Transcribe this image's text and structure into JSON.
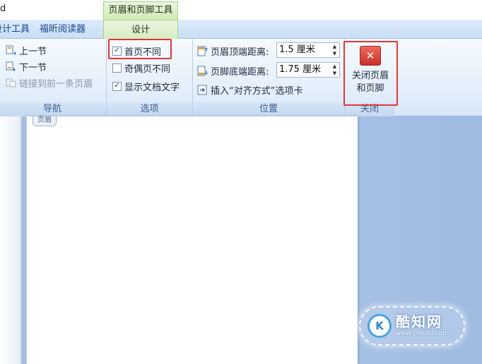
{
  "titlebar": {
    "doc_title": "d",
    "context_tool": "页眉和页脚工具"
  },
  "tabs": {
    "items": [
      {
        "label": "设计工具"
      },
      {
        "label": "福昕阅读器"
      },
      {
        "label": "设计"
      }
    ]
  },
  "ribbon": {
    "navigation": {
      "label": "导航",
      "items": [
        {
          "label": "上一节"
        },
        {
          "label": "下一节"
        },
        {
          "label": "链接到前一条页眉"
        }
      ]
    },
    "options": {
      "label": "选项",
      "items": [
        {
          "label": "首页不同",
          "checked": true,
          "mark": "✓"
        },
        {
          "label": "奇偶页不同",
          "checked": false,
          "mark": ""
        },
        {
          "label": "显示文档文字",
          "checked": true,
          "mark": "✓"
        }
      ]
    },
    "position": {
      "label": "位置",
      "header_top_label": "页眉顶端距离:",
      "header_top_value": "1.5 厘米",
      "footer_bottom_label": "页脚底端距离:",
      "footer_bottom_value": "1.75 厘米",
      "insert_align_tab": "插入“对齐方式”选项卡"
    },
    "close": {
      "label": "关闭",
      "button_line1": "关闭页眉",
      "button_line2": "和页脚",
      "icon_glyph": "✕"
    }
  },
  "document": {
    "header_tag": "页眉"
  },
  "watermark": {
    "logo_glyph": "K",
    "name": "酷知网",
    "url": "www.coozhi.com"
  },
  "colors": {
    "highlight": "#e0373a",
    "ribbon_tab": "#c9def6",
    "context_green": "#cfeab6",
    "close_red": "#d9443a"
  }
}
